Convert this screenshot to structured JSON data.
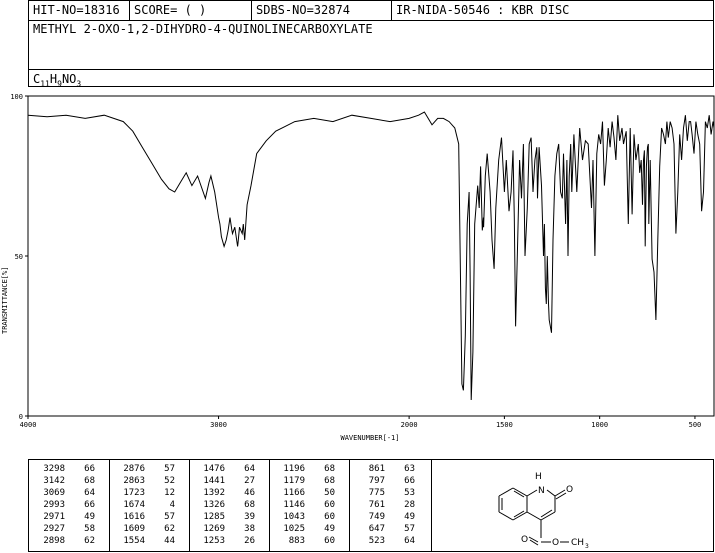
{
  "header": {
    "hit_no": "HIT-NO=18316",
    "score": "SCORE=  (   )",
    "sdbs_no": "SDBS-NO=32874",
    "source": "IR-NIDA-50546 : KBR DISC",
    "compound_name": "METHYL 2-OXO-1,2-DIHYDRO-4-QUINOLINECARBOXYLATE",
    "formula_parts": [
      "C",
      "11",
      "H",
      "9",
      "NO",
      "3"
    ]
  },
  "chart_data": {
    "type": "line",
    "xlabel": "WAVENUMBER[-1]",
    "ylabel": "TRANSMITTANCE[%]",
    "xlim": [
      4000,
      400
    ],
    "ylim": [
      0,
      100
    ],
    "x_ticks": [
      4000,
      3000,
      2000,
      1500,
      1000,
      500
    ],
    "y_ticks": [
      0,
      50,
      100
    ],
    "x": [
      4000,
      3900,
      3800,
      3700,
      3600,
      3500,
      3450,
      3400,
      3350,
      3300,
      3260,
      3230,
      3200,
      3170,
      3140,
      3110,
      3069,
      3050,
      3040,
      3020,
      3000,
      2993,
      2985,
      2971,
      2960,
      2950,
      2940,
      2930,
      2927,
      2915,
      2900,
      2898,
      2890,
      2876,
      2870,
      2863,
      2850,
      2830,
      2800,
      2750,
      2700,
      2600,
      2500,
      2400,
      2300,
      2200,
      2100,
      2000,
      1950,
      1920,
      1900,
      1880,
      1850,
      1820,
      1790,
      1760,
      1740,
      1723,
      1715,
      1705,
      1695,
      1685,
      1680,
      1674,
      1665,
      1656,
      1640,
      1632,
      1625,
      1616,
      1610,
      1609,
      1600,
      1590,
      1584,
      1575,
      1565,
      1554,
      1545,
      1530,
      1515,
      1500,
      1490,
      1476,
      1465,
      1455,
      1448,
      1441,
      1430,
      1420,
      1410,
      1400,
      1392,
      1380,
      1370,
      1360,
      1350,
      1340,
      1330,
      1326,
      1318,
      1305,
      1295,
      1290,
      1285,
      1280,
      1275,
      1269,
      1265,
      1253,
      1245,
      1235,
      1225,
      1215,
      1205,
      1196,
      1190,
      1179,
      1172,
      1166,
      1160,
      1152,
      1146,
      1135,
      1120,
      1105,
      1090,
      1075,
      1060,
      1043,
      1035,
      1025,
      1015,
      1005,
      995,
      985,
      975,
      965,
      955,
      945,
      935,
      925,
      915,
      905,
      895,
      883,
      875,
      861,
      850,
      840,
      830,
      820,
      810,
      800,
      797,
      790,
      782,
      775,
      770,
      765,
      761,
      755,
      749,
      745,
      742,
      735,
      725,
      715,
      705,
      695,
      685,
      675,
      665,
      655,
      647,
      640,
      630,
      620,
      610,
      600,
      590,
      580,
      570,
      560,
      550,
      540,
      530,
      523,
      515,
      505,
      495,
      485,
      475,
      465,
      455,
      445,
      435,
      425,
      415,
      405,
      400
    ],
    "y": [
      94,
      93.5,
      94,
      93,
      94,
      92,
      89,
      84,
      79,
      74,
      71,
      70,
      73,
      76,
      72,
      75,
      68,
      73,
      75,
      70,
      62,
      60,
      56,
      53,
      55,
      58,
      62,
      58,
      57,
      59,
      53,
      54,
      59,
      57,
      60,
      55,
      66,
      72,
      82,
      86,
      89,
      92,
      93,
      92,
      94,
      93,
      92,
      93,
      94,
      95,
      93,
      91,
      93,
      93,
      92,
      90,
      85,
      10,
      8,
      25,
      60,
      70,
      45,
      5,
      20,
      60,
      72,
      65,
      78,
      58,
      62,
      59,
      75,
      82,
      77,
      70,
      55,
      46,
      65,
      80,
      87,
      70,
      80,
      64,
      70,
      83,
      62,
      28,
      55,
      80,
      68,
      85,
      50,
      65,
      85,
      87,
      70,
      80,
      84,
      68,
      84,
      72,
      50,
      60,
      40,
      35,
      50,
      36,
      30,
      26,
      55,
      75,
      82,
      85,
      70,
      68,
      82,
      60,
      80,
      50,
      75,
      85,
      70,
      88,
      70,
      90,
      80,
      86,
      85,
      65,
      80,
      50,
      82,
      88,
      85,
      92,
      72,
      80,
      90,
      84,
      92,
      87,
      80,
      94,
      86,
      90,
      85,
      89,
      60,
      90,
      63,
      88,
      80,
      84,
      85,
      76,
      80,
      66,
      80,
      83,
      53,
      78,
      84,
      85,
      60,
      80,
      49,
      45,
      30,
      55,
      78,
      90,
      88,
      85,
      92,
      87,
      92,
      90,
      85,
      57,
      70,
      88,
      80,
      90,
      94,
      86,
      92,
      92,
      88,
      82,
      92,
      88,
      85,
      64,
      70,
      92,
      90,
      94,
      88,
      92,
      90,
      80,
      82,
      80
    ]
  },
  "peaks": [
    [
      [
        "3298",
        "66"
      ],
      [
        "3142",
        "68"
      ],
      [
        "3069",
        "64"
      ],
      [
        "2993",
        "66"
      ],
      [
        "2971",
        "49"
      ],
      [
        "2927",
        "58"
      ],
      [
        "2898",
        "62"
      ]
    ],
    [
      [
        "2876",
        "57"
      ],
      [
        "2863",
        "52"
      ],
      [
        "1723",
        "12"
      ],
      [
        "1674",
        "4"
      ],
      [
        "1616",
        "57"
      ],
      [
        "1609",
        "62"
      ],
      [
        "1554",
        "44"
      ]
    ],
    [
      [
        "1476",
        "64"
      ],
      [
        "1441",
        "27"
      ],
      [
        "1392",
        "46"
      ],
      [
        "1326",
        "68"
      ],
      [
        "1285",
        "39"
      ],
      [
        "1269",
        "38"
      ],
      [
        "1253",
        "26"
      ]
    ],
    [
      [
        "1196",
        "68"
      ],
      [
        "1179",
        "68"
      ],
      [
        "1166",
        "50"
      ],
      [
        "1146",
        "60"
      ],
      [
        "1043",
        "60"
      ],
      [
        "1025",
        "49"
      ],
      [
        "883",
        "60"
      ]
    ],
    [
      [
        "861",
        "63"
      ],
      [
        "797",
        "66"
      ],
      [
        "775",
        "53"
      ],
      [
        "761",
        "28"
      ],
      [
        "749",
        "49"
      ],
      [
        "647",
        "57"
      ],
      [
        "523",
        "64"
      ]
    ]
  ],
  "structure": {
    "nh_label": "H",
    "n_label": "N",
    "oxo_label": "O",
    "ester_o1": "O",
    "ester_o2": "O",
    "methyl": "CH",
    "methyl_sub": "3"
  }
}
